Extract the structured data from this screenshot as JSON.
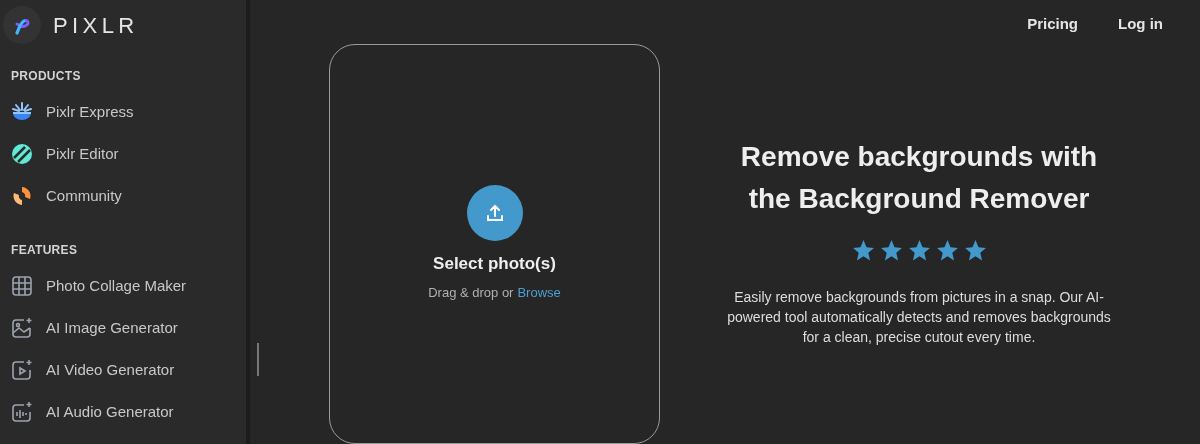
{
  "brand": {
    "name": "PIXLR"
  },
  "sidebar": {
    "sections": [
      {
        "heading": "PRODUCTS",
        "items": [
          {
            "label": "Pixlr Express",
            "kind": "express"
          },
          {
            "label": "Pixlr Editor",
            "kind": "editor"
          },
          {
            "label": "Community",
            "kind": "community"
          }
        ]
      },
      {
        "heading": "FEATURES",
        "items": [
          {
            "label": "Photo Collage Maker",
            "kind": "collage"
          },
          {
            "label": "AI Image Generator",
            "kind": "image"
          },
          {
            "label": "AI Video Generator",
            "kind": "video"
          },
          {
            "label": "AI Audio Generator",
            "kind": "audio"
          }
        ]
      }
    ]
  },
  "nav": [
    "Pricing",
    "Log in"
  ],
  "upload": {
    "title": "Select photo(s)",
    "hint": "Drag & drop or",
    "link": "Browse"
  },
  "hero": {
    "title": "Remove backgrounds with the Background Remover",
    "stars": 5,
    "description": "Easily remove backgrounds from pictures in a snap. Our AI-powered tool automatically detects and removes backgrounds for a clean, precise cutout every time."
  }
}
